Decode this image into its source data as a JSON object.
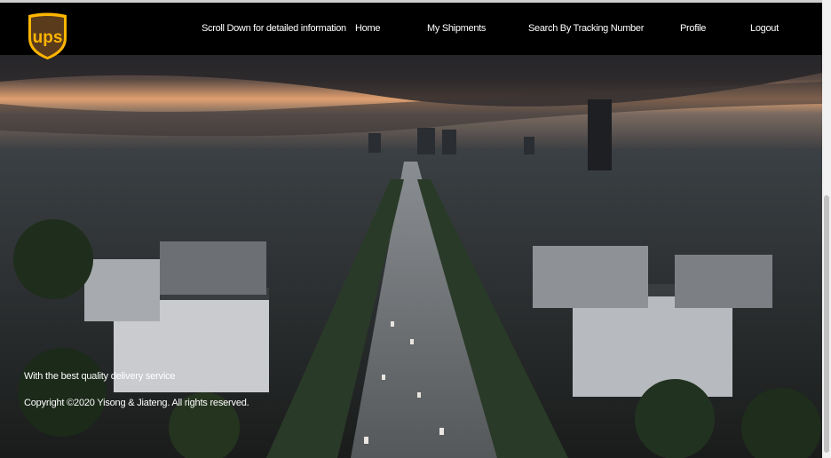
{
  "brand": {
    "logo_text": "ups",
    "brand_color": "#ffb500",
    "logo_bg": "#5a3b1c"
  },
  "nav": {
    "items": [
      {
        "label": "Scroll Down for detailed information"
      },
      {
        "label": "Home"
      },
      {
        "label": "My Shipments"
      },
      {
        "label": "Search By Tracking Number"
      },
      {
        "label": "Profile"
      },
      {
        "label": "Logout"
      }
    ]
  },
  "hero": {
    "image": "paris-avenue-aerial-photo"
  },
  "footer": {
    "tagline": "With the best quality delivery service",
    "copyright": "Copyright ©2020 Yisong & Jiateng. All rights reserved."
  }
}
